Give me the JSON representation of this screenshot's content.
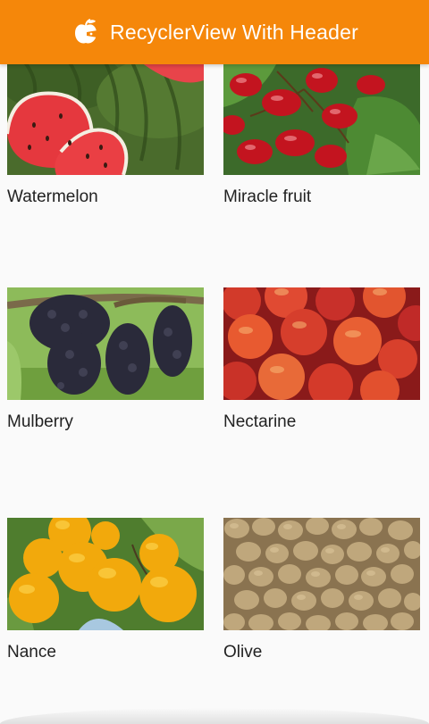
{
  "app": {
    "title": "RecyclerView With Header",
    "icon": "fruit-logo-icon"
  },
  "colors": {
    "toolbar": "#f5870a",
    "background": "#fafafa"
  },
  "fruits": [
    {
      "name": "Watermelon"
    },
    {
      "name": "Miracle fruit"
    },
    {
      "name": "Mulberry"
    },
    {
      "name": "Nectarine"
    },
    {
      "name": "Nance"
    },
    {
      "name": "Olive"
    }
  ]
}
